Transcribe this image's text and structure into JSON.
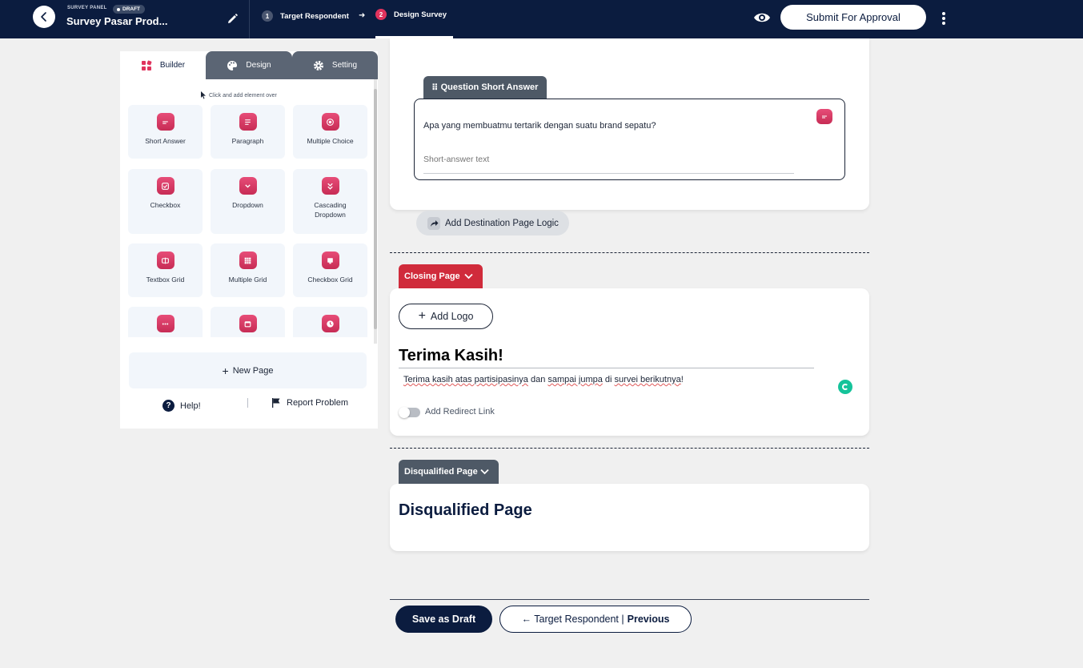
{
  "header": {
    "panel_label": "SURVEY PANEL",
    "status_badge": "DRAFT",
    "survey_title": "Survey Pasar Prod...",
    "steps": [
      {
        "num": "1",
        "label": "Target Respondent"
      },
      {
        "num": "2",
        "label": "Design Survey"
      }
    ],
    "submit_label": "Submit For Approval"
  },
  "left_panel": {
    "tabs": [
      {
        "label": "Builder",
        "icon": "builder-icon"
      },
      {
        "label": "Design",
        "icon": "palette-icon"
      },
      {
        "label": "Setting",
        "icon": "gear-icon"
      }
    ],
    "hint": "Click and add element over",
    "elements": [
      {
        "label": "Short Answer",
        "icon": "short-answer-icon"
      },
      {
        "label": "Paragraph",
        "icon": "paragraph-icon"
      },
      {
        "label": "Multiple Choice",
        "icon": "radio-icon"
      },
      {
        "label": "Checkbox",
        "icon": "checkbox-icon"
      },
      {
        "label": "Dropdown",
        "icon": "dropdown-icon"
      },
      {
        "label": "Cascading Dropdown",
        "icon": "cascading-dropdown-icon"
      },
      {
        "label": "Textbox Grid",
        "icon": "textbox-grid-icon"
      },
      {
        "label": "Multiple Grid",
        "icon": "multiple-grid-icon"
      },
      {
        "label": "Checkbox Grid",
        "icon": "checkbox-grid-icon"
      },
      {
        "label": "",
        "icon": "dots-icon"
      },
      {
        "label": "",
        "icon": "calendar-icon"
      },
      {
        "label": "",
        "icon": "clock-icon"
      }
    ],
    "new_page_label": "New Page",
    "help_label": "Help!",
    "report_label": "Report Problem"
  },
  "question": {
    "tag_label": "Question Short Answer",
    "text": "Apa yang membuatmu tertarik dengan suatu brand sepatu?",
    "placeholder": "Short-answer text"
  },
  "logic_label": "Add Destination Page Logic",
  "closing": {
    "tag_label": "Closing Page",
    "add_logo_label": "Add Logo",
    "title": "Terima Kasih!",
    "message_parts": [
      {
        "t": "Terima kasih atas partisipasinya",
        "sq": true
      },
      {
        "t": " dan ",
        "sq": false
      },
      {
        "t": "sampai jumpa",
        "sq": true
      },
      {
        "t": " di ",
        "sq": false
      },
      {
        "t": "survei berikutnya",
        "sq": true
      },
      {
        "t": "!",
        "sq": false
      }
    ],
    "redirect_label": "Add Redirect Link",
    "redirect_enabled": false
  },
  "disqualified": {
    "tag_label": "Disqualified Page",
    "title": "Disqualified Page"
  },
  "footer": {
    "save_draft_label": "Save as Draft",
    "prev_label": "← Target Respondent |",
    "prev_bold": "Previous"
  },
  "colors": {
    "navy": "#0b1c3f",
    "accent_pink": "#e0335d",
    "closing_red": "#d02b3b",
    "tag_gray": "#4e5966"
  }
}
